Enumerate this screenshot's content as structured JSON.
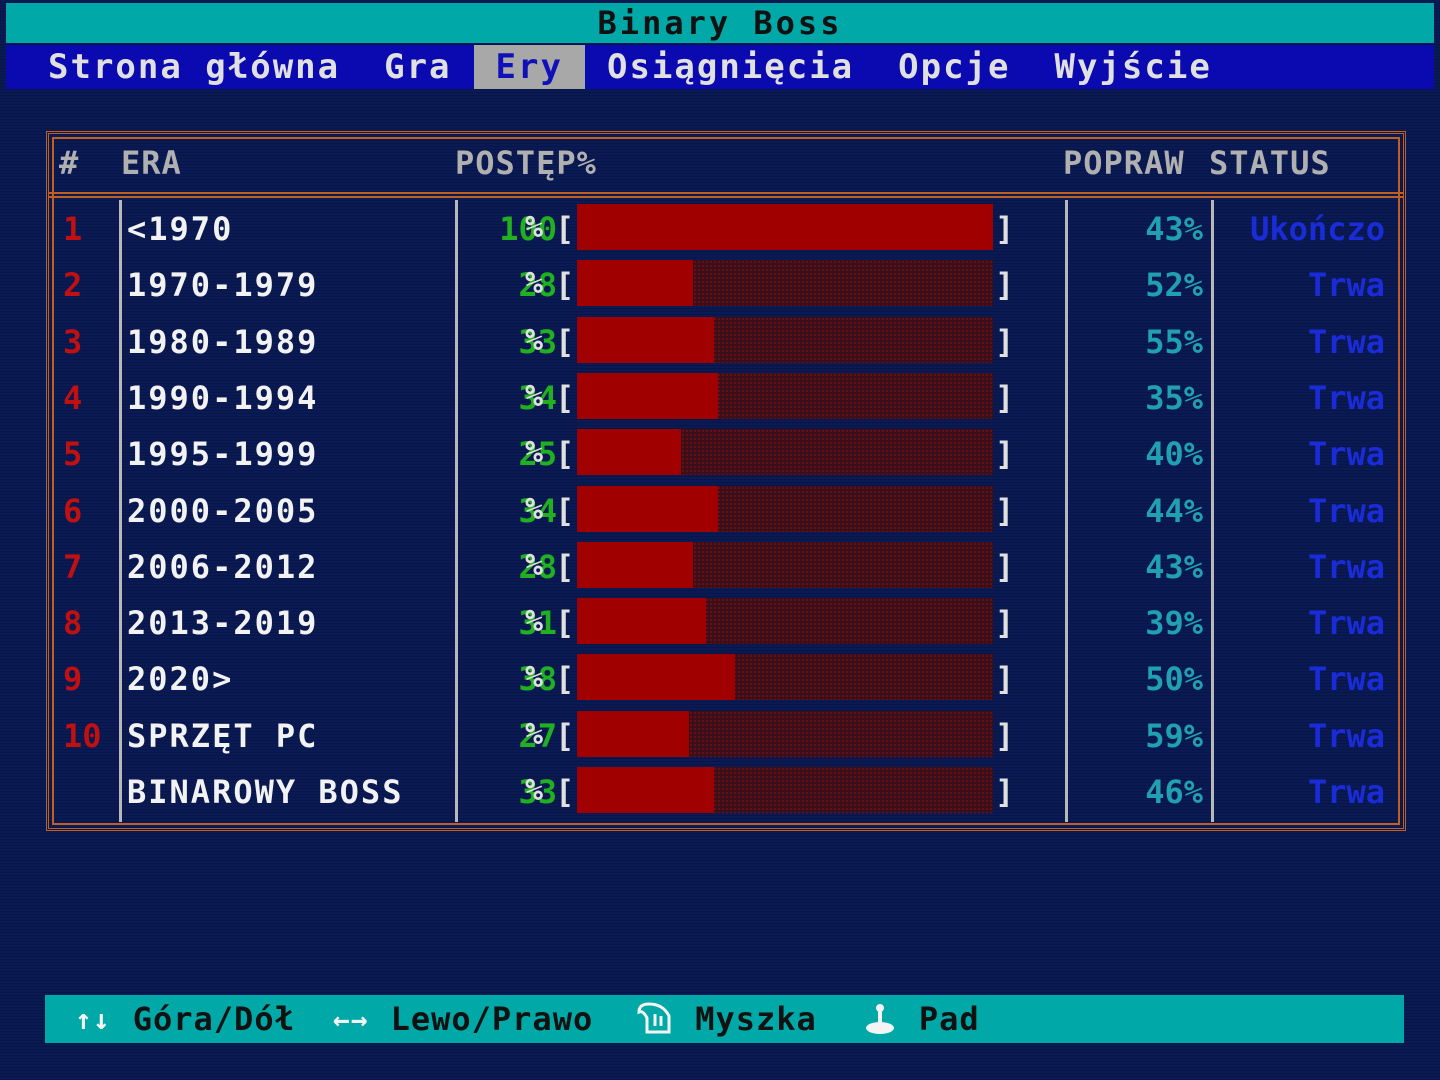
{
  "app": {
    "title": "Binary Boss"
  },
  "menu": [
    {
      "label": "Strona główna",
      "active": false
    },
    {
      "label": "Gra",
      "active": false
    },
    {
      "label": "Ery",
      "active": true
    },
    {
      "label": "Osiągnięcia",
      "active": false
    },
    {
      "label": "Opcje",
      "active": false
    },
    {
      "label": "Wyjście",
      "active": false
    }
  ],
  "table": {
    "headers": {
      "num": "#",
      "era": "ERA",
      "progress": "POSTĘP%",
      "fix": "POPRAW",
      "status": "STATUS"
    },
    "rows": [
      {
        "num": "1",
        "era": "<1970",
        "progress": 100,
        "fix": "43%",
        "status": "Ukończo"
      },
      {
        "num": "2",
        "era": "1970-1979",
        "progress": 28,
        "fix": "52%",
        "status": "Trwa"
      },
      {
        "num": "3",
        "era": "1980-1989",
        "progress": 33,
        "fix": "55%",
        "status": "Trwa"
      },
      {
        "num": "4",
        "era": "1990-1994",
        "progress": 34,
        "fix": "35%",
        "status": "Trwa"
      },
      {
        "num": "5",
        "era": "1995-1999",
        "progress": 25,
        "fix": "40%",
        "status": "Trwa"
      },
      {
        "num": "6",
        "era": "2000-2005",
        "progress": 34,
        "fix": "44%",
        "status": "Trwa"
      },
      {
        "num": "7",
        "era": "2006-2012",
        "progress": 28,
        "fix": "43%",
        "status": "Trwa"
      },
      {
        "num": "8",
        "era": "2013-2019",
        "progress": 31,
        "fix": "39%",
        "status": "Trwa"
      },
      {
        "num": "9",
        "era": "2020>",
        "progress": 38,
        "fix": "50%",
        "status": "Trwa"
      },
      {
        "num": "10",
        "era": "SPRZĘT PC",
        "progress": 27,
        "fix": "59%",
        "status": "Trwa"
      },
      {
        "num": "",
        "era": "BINAROWY BOSS",
        "progress": 33,
        "fix": "46%",
        "status": "Trwa"
      }
    ]
  },
  "footer": {
    "items": [
      {
        "icon": "up-down-arrows-icon",
        "glyph": "↑↓",
        "label": "Góra/Dół"
      },
      {
        "icon": "left-right-arrows-icon",
        "glyph": "←→",
        "label": "Lewo/Prawo"
      },
      {
        "icon": "mouse-icon",
        "glyph": "",
        "label": "Myszka"
      },
      {
        "icon": "joystick-icon",
        "glyph": "",
        "label": "Pad"
      }
    ]
  },
  "colors": {
    "title_bg": "#00a8a8",
    "menu_bg": "#0a0ab0",
    "menu_active_bg": "#a8a8a8",
    "screen_bg": "#0a1a55",
    "border": "#c06020",
    "bar_fill": "#a00000",
    "progress_text": "#20b020",
    "fix_text": "#20a0b0",
    "status_text": "#1a2cd8",
    "num_text": "#c01010"
  }
}
